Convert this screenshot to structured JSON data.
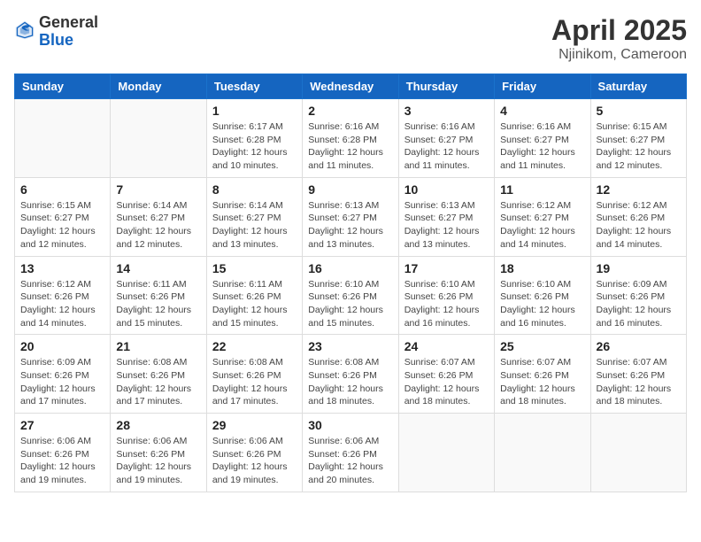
{
  "header": {
    "logo_general": "General",
    "logo_blue": "Blue",
    "month_year": "April 2025",
    "location": "Njinikom, Cameroon"
  },
  "days_of_week": [
    "Sunday",
    "Monday",
    "Tuesday",
    "Wednesday",
    "Thursday",
    "Friday",
    "Saturday"
  ],
  "weeks": [
    [
      {
        "day": "",
        "info": ""
      },
      {
        "day": "",
        "info": ""
      },
      {
        "day": "1",
        "info": "Sunrise: 6:17 AM\nSunset: 6:28 PM\nDaylight: 12 hours\nand 10 minutes."
      },
      {
        "day": "2",
        "info": "Sunrise: 6:16 AM\nSunset: 6:28 PM\nDaylight: 12 hours\nand 11 minutes."
      },
      {
        "day": "3",
        "info": "Sunrise: 6:16 AM\nSunset: 6:27 PM\nDaylight: 12 hours\nand 11 minutes."
      },
      {
        "day": "4",
        "info": "Sunrise: 6:16 AM\nSunset: 6:27 PM\nDaylight: 12 hours\nand 11 minutes."
      },
      {
        "day": "5",
        "info": "Sunrise: 6:15 AM\nSunset: 6:27 PM\nDaylight: 12 hours\nand 12 minutes."
      }
    ],
    [
      {
        "day": "6",
        "info": "Sunrise: 6:15 AM\nSunset: 6:27 PM\nDaylight: 12 hours\nand 12 minutes."
      },
      {
        "day": "7",
        "info": "Sunrise: 6:14 AM\nSunset: 6:27 PM\nDaylight: 12 hours\nand 12 minutes."
      },
      {
        "day": "8",
        "info": "Sunrise: 6:14 AM\nSunset: 6:27 PM\nDaylight: 12 hours\nand 13 minutes."
      },
      {
        "day": "9",
        "info": "Sunrise: 6:13 AM\nSunset: 6:27 PM\nDaylight: 12 hours\nand 13 minutes."
      },
      {
        "day": "10",
        "info": "Sunrise: 6:13 AM\nSunset: 6:27 PM\nDaylight: 12 hours\nand 13 minutes."
      },
      {
        "day": "11",
        "info": "Sunrise: 6:12 AM\nSunset: 6:27 PM\nDaylight: 12 hours\nand 14 minutes."
      },
      {
        "day": "12",
        "info": "Sunrise: 6:12 AM\nSunset: 6:26 PM\nDaylight: 12 hours\nand 14 minutes."
      }
    ],
    [
      {
        "day": "13",
        "info": "Sunrise: 6:12 AM\nSunset: 6:26 PM\nDaylight: 12 hours\nand 14 minutes."
      },
      {
        "day": "14",
        "info": "Sunrise: 6:11 AM\nSunset: 6:26 PM\nDaylight: 12 hours\nand 15 minutes."
      },
      {
        "day": "15",
        "info": "Sunrise: 6:11 AM\nSunset: 6:26 PM\nDaylight: 12 hours\nand 15 minutes."
      },
      {
        "day": "16",
        "info": "Sunrise: 6:10 AM\nSunset: 6:26 PM\nDaylight: 12 hours\nand 15 minutes."
      },
      {
        "day": "17",
        "info": "Sunrise: 6:10 AM\nSunset: 6:26 PM\nDaylight: 12 hours\nand 16 minutes."
      },
      {
        "day": "18",
        "info": "Sunrise: 6:10 AM\nSunset: 6:26 PM\nDaylight: 12 hours\nand 16 minutes."
      },
      {
        "day": "19",
        "info": "Sunrise: 6:09 AM\nSunset: 6:26 PM\nDaylight: 12 hours\nand 16 minutes."
      }
    ],
    [
      {
        "day": "20",
        "info": "Sunrise: 6:09 AM\nSunset: 6:26 PM\nDaylight: 12 hours\nand 17 minutes."
      },
      {
        "day": "21",
        "info": "Sunrise: 6:08 AM\nSunset: 6:26 PM\nDaylight: 12 hours\nand 17 minutes."
      },
      {
        "day": "22",
        "info": "Sunrise: 6:08 AM\nSunset: 6:26 PM\nDaylight: 12 hours\nand 17 minutes."
      },
      {
        "day": "23",
        "info": "Sunrise: 6:08 AM\nSunset: 6:26 PM\nDaylight: 12 hours\nand 18 minutes."
      },
      {
        "day": "24",
        "info": "Sunrise: 6:07 AM\nSunset: 6:26 PM\nDaylight: 12 hours\nand 18 minutes."
      },
      {
        "day": "25",
        "info": "Sunrise: 6:07 AM\nSunset: 6:26 PM\nDaylight: 12 hours\nand 18 minutes."
      },
      {
        "day": "26",
        "info": "Sunrise: 6:07 AM\nSunset: 6:26 PM\nDaylight: 12 hours\nand 18 minutes."
      }
    ],
    [
      {
        "day": "27",
        "info": "Sunrise: 6:06 AM\nSunset: 6:26 PM\nDaylight: 12 hours\nand 19 minutes."
      },
      {
        "day": "28",
        "info": "Sunrise: 6:06 AM\nSunset: 6:26 PM\nDaylight: 12 hours\nand 19 minutes."
      },
      {
        "day": "29",
        "info": "Sunrise: 6:06 AM\nSunset: 6:26 PM\nDaylight: 12 hours\nand 19 minutes."
      },
      {
        "day": "30",
        "info": "Sunrise: 6:06 AM\nSunset: 6:26 PM\nDaylight: 12 hours\nand 20 minutes."
      },
      {
        "day": "",
        "info": ""
      },
      {
        "day": "",
        "info": ""
      },
      {
        "day": "",
        "info": ""
      }
    ]
  ]
}
